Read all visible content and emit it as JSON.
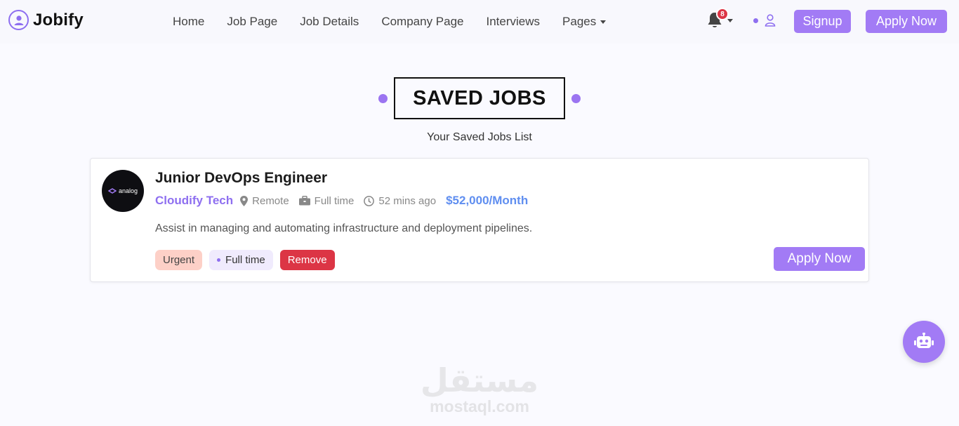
{
  "brand": {
    "name": "Jobify",
    "icon": "user-circle-icon"
  },
  "nav": {
    "links": [
      "Home",
      "Job Page",
      "Job Details",
      "Company Page",
      "Interviews",
      "Pages"
    ],
    "notification_count": "8",
    "signup_label": "Signup",
    "apply_label": "Apply Now"
  },
  "header": {
    "title": "SAVED JOBS",
    "subtitle": "Your Saved Jobs List"
  },
  "job": {
    "logo_text": "analog",
    "title": "Junior DevOps Engineer",
    "company": "Cloudify Tech",
    "location": "Remote",
    "type": "Full time",
    "posted": "52 mins ago",
    "salary": "$52,000/Month",
    "description": "Assist in managing and automating infrastructure and deployment pipelines.",
    "tags": {
      "urgent": "Urgent",
      "type": "Full time",
      "remove": "Remove"
    },
    "apply_label": "Apply Now"
  },
  "watermark": {
    "arabic": "مستقل",
    "latin": "mostaql.com"
  },
  "colors": {
    "accent": "#a27bf5",
    "brand_purple": "#8e6ff0",
    "salary_blue": "#5f8ef0",
    "danger": "#dc3545",
    "urgent_bg": "#fdd0c7"
  }
}
